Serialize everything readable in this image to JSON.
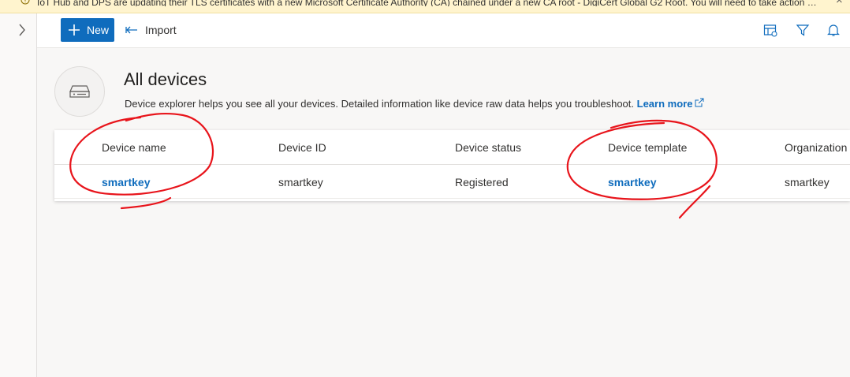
{
  "banner": {
    "text": "IoT Hub and DPS are updating their TLS certificates with a new Microsoft Certificate Authority (CA) chained under a new CA root - DigiCert Global G2 Root. You will need to take action to e...",
    "icon": "warning-icon",
    "close": "×"
  },
  "toolbar": {
    "new_label": "New",
    "import_label": "Import"
  },
  "page": {
    "title": "All devices",
    "description": "Device explorer helps you see all your devices. Detailed information like device raw data helps you troubleshoot.",
    "learn_more": "Learn more"
  },
  "table": {
    "columns": [
      "Device name",
      "Device ID",
      "Device status",
      "Device template",
      "Organization"
    ],
    "rows": [
      {
        "device_name": "smartkey",
        "device_id": "smartkey",
        "device_status": "Registered",
        "device_template": "smartkey",
        "organization": "smartkey"
      }
    ]
  },
  "colors": {
    "accent": "#0f6cbd",
    "banner_bg": "#fff4ce",
    "annotation_ink": "#e8141b"
  }
}
